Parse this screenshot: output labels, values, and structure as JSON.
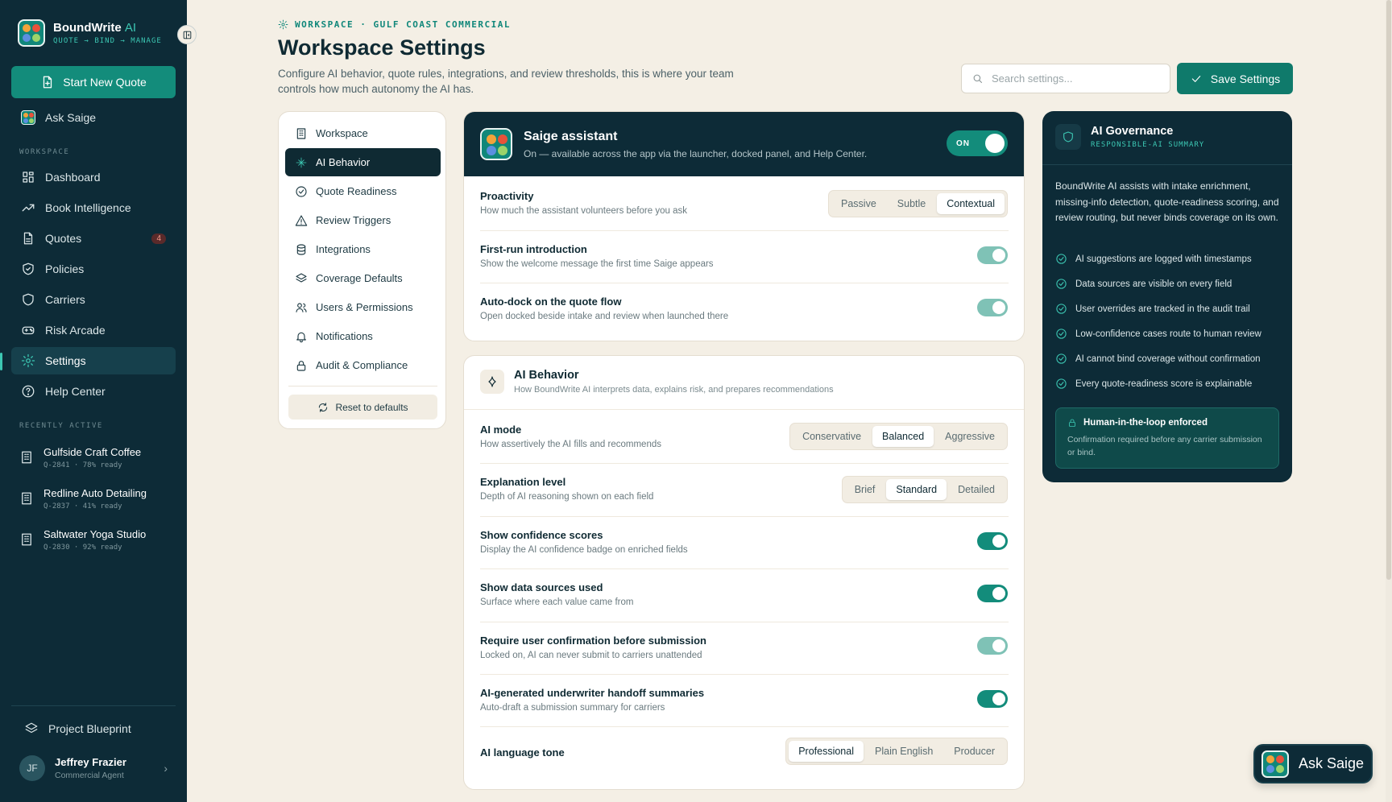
{
  "brand": {
    "name": "BoundWrite",
    "ai": "AI",
    "tagline": "QUOTE → BIND → MANAGE"
  },
  "sidebar": {
    "start_quote": "Start New Quote",
    "ask_saige": "Ask Saige",
    "section_workspace": "WORKSPACE",
    "items": [
      {
        "label": "Dashboard",
        "icon": "grid-icon"
      },
      {
        "label": "Book Intelligence",
        "icon": "trend-icon"
      },
      {
        "label": "Quotes",
        "icon": "file-icon",
        "badge": "4"
      },
      {
        "label": "Policies",
        "icon": "shield-check-icon"
      },
      {
        "label": "Carriers",
        "icon": "shield-icon"
      },
      {
        "label": "Risk Arcade",
        "icon": "gamepad-icon"
      },
      {
        "label": "Settings",
        "icon": "gear-icon"
      },
      {
        "label": "Help Center",
        "icon": "help-icon"
      }
    ],
    "section_recent": "RECENTLY ACTIVE",
    "recent": [
      {
        "title": "Gulfside Craft Coffee",
        "meta": "Q-2841 · 78% ready"
      },
      {
        "title": "Redline Auto Detailing",
        "meta": "Q-2837 · 41% ready"
      },
      {
        "title": "Saltwater Yoga Studio",
        "meta": "Q-2830 · 92% ready"
      }
    ],
    "blueprint": "Project Blueprint",
    "user": {
      "initials": "JF",
      "name": "Jeffrey Frazier",
      "role": "Commercial Agent"
    }
  },
  "header": {
    "crumb": "WORKSPACE · GULF COAST COMMERCIAL",
    "title": "Workspace Settings",
    "description": "Configure AI behavior, quote rules, integrations, and review thresholds, this is where your team controls how much autonomy the AI has.",
    "search_placeholder": "Search settings...",
    "save": "Save Settings"
  },
  "settings_nav": {
    "items": [
      {
        "label": "Workspace",
        "icon": "building-icon"
      },
      {
        "label": "AI Behavior",
        "icon": "sparkle-icon"
      },
      {
        "label": "Quote Readiness",
        "icon": "check-circle-icon"
      },
      {
        "label": "Review Triggers",
        "icon": "warning-icon"
      },
      {
        "label": "Integrations",
        "icon": "database-icon"
      },
      {
        "label": "Coverage Defaults",
        "icon": "layers-icon"
      },
      {
        "label": "Users & Permissions",
        "icon": "users-icon"
      },
      {
        "label": "Notifications",
        "icon": "bell-icon"
      },
      {
        "label": "Audit & Compliance",
        "icon": "lock-icon"
      }
    ],
    "active": "AI Behavior",
    "reset": "Reset to defaults"
  },
  "saige": {
    "title": "Saige assistant",
    "subtitle": "On — available across the app via the launcher, docked panel, and Help Center.",
    "toggle": "ON",
    "proactivity": {
      "label": "Proactivity",
      "desc": "How much the assistant volunteers before you ask",
      "options": [
        "Passive",
        "Subtle",
        "Contextual"
      ],
      "selected": "Contextual"
    },
    "first_run": {
      "label": "First-run introduction",
      "desc": "Show the welcome message the first time Saige appears",
      "on": true
    },
    "auto_dock": {
      "label": "Auto-dock on the quote flow",
      "desc": "Open docked beside intake and review when launched there",
      "on": true
    }
  },
  "ai_behavior": {
    "title": "AI Behavior",
    "subtitle": "How BoundWrite AI interprets data, explains risk, and prepares recommendations",
    "mode": {
      "label": "AI mode",
      "desc": "How assertively the AI fills and recommends",
      "options": [
        "Conservative",
        "Balanced",
        "Aggressive"
      ],
      "selected": "Balanced"
    },
    "explanation": {
      "label": "Explanation level",
      "desc": "Depth of AI reasoning shown on each field",
      "options": [
        "Brief",
        "Standard",
        "Detailed"
      ],
      "selected": "Standard"
    },
    "confidence": {
      "label": "Show confidence scores",
      "desc": "Display the AI confidence badge on enriched fields",
      "on": true
    },
    "sources": {
      "label": "Show data sources used",
      "desc": "Surface where each value came from",
      "on": true
    },
    "confirmation": {
      "label": "Require user confirmation before submission",
      "desc": "Locked on, AI can never submit to carriers unattended",
      "on": true,
      "locked": true
    },
    "handoff": {
      "label": "AI-generated underwriter handoff summaries",
      "desc": "Auto-draft a submission summary for carriers",
      "on": true
    },
    "tone": {
      "label": "AI language tone",
      "options": [
        "Professional",
        "Plain English",
        "Producer"
      ],
      "selected": "Professional"
    }
  },
  "governance": {
    "title": "AI Governance",
    "subtitle": "RESPONSIBLE-AI SUMMARY",
    "intro": "BoundWrite AI assists with intake enrichment, missing-info detection, quote-readiness scoring, and review routing, but never binds coverage on its own.",
    "items": [
      "AI suggestions are logged with timestamps",
      "Data sources are visible on every field",
      "User overrides are tracked in the audit trail",
      "Low-confidence cases route to human review",
      "AI cannot bind coverage without confirmation",
      "Every quote-readiness score is explainable"
    ],
    "hitl_title": "Human-in-the-loop enforced",
    "hitl_desc": "Confirmation required before any carrier submission or bind."
  },
  "ask_float": "Ask Saige",
  "colors": {
    "accent": "#138c7b",
    "sidebar": "#0d2b37",
    "background": "#f4efe5",
    "teal_text": "#3cc7b3"
  }
}
